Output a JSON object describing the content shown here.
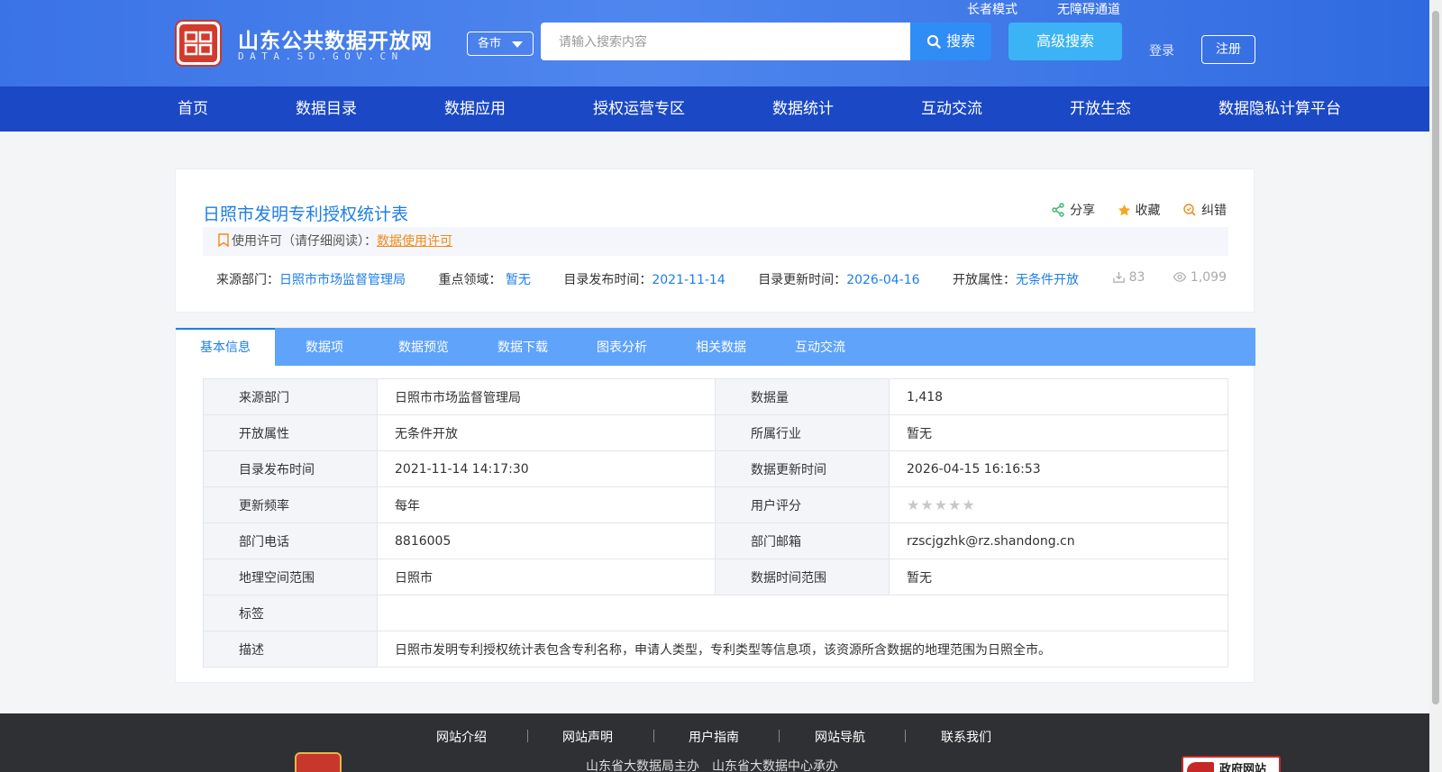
{
  "header": {
    "logo_title": "山东公共数据开放网",
    "logo_subtitle": "DATA.SD.GOV.CN",
    "city_select": "各市",
    "search_placeholder": "请输入搜索内容",
    "search_button": "搜索",
    "advanced_search": "高级搜索",
    "elder_mode": "长者模式",
    "accessibility": "无障碍通道",
    "login": "登录",
    "register": "注册"
  },
  "nav": {
    "items": [
      "首页",
      "数据目录",
      "数据应用",
      "授权运营专区",
      "数据统计",
      "互动交流",
      "开放生态",
      "数据隐私计算平台"
    ]
  },
  "dataset": {
    "title": "日照市发明专利授权统计表",
    "actions": {
      "share": "分享",
      "favorite": "收藏",
      "report": "纠错"
    },
    "license_label": "使用许可（请仔细阅读）：",
    "license_link": "数据使用许可",
    "meta": {
      "source_label": "来源部门：",
      "source_value": "日照市市场监督管理局",
      "domain_label": "重点领域：",
      "domain_value": "暂无",
      "publish_label": "目录发布时间：",
      "publish_value": "2021-11-14",
      "update_label": "目录更新时间：",
      "update_value": "2026-04-16",
      "open_label": "开放属性：",
      "open_value": "无条件开放"
    },
    "downloads": "83",
    "views": "1,099"
  },
  "tabs": [
    "基本信息",
    "数据项",
    "数据预览",
    "数据下载",
    "图表分析",
    "相关数据",
    "互动交流"
  ],
  "info_table": {
    "rows": [
      {
        "k1": "来源部门",
        "v1": "日照市市场监督管理局",
        "k2": "数据量",
        "v2": "1,418"
      },
      {
        "k1": "开放属性",
        "v1": "无条件开放",
        "k2": "所属行业",
        "v2": "暂无"
      },
      {
        "k1": "目录发布时间",
        "v1": "2021-11-14 14:17:30",
        "k2": "数据更新时间",
        "v2": "2026-04-15 16:16:53"
      },
      {
        "k1": "更新频率",
        "v1": "每年",
        "k2": "用户评分",
        "v2": ""
      },
      {
        "k1": "部门电话",
        "v1": "8816005",
        "k2": "部门邮箱",
        "v2": "rzscjgzhk@rz.shandong.cn"
      },
      {
        "k1": "地理空间范围",
        "v1": "日照市",
        "k2": "数据时间范围",
        "v2": "暂无"
      }
    ],
    "tags_label": "标签",
    "tags_value": "",
    "desc_label": "描述",
    "desc_value": "日照市发明专利授权统计表包含专利名称，申请人类型，专利类型等信息项，该资源所含数据的地理范围为日照全市。",
    "rating_stars": 0
  },
  "footer": {
    "links": [
      "网站介绍",
      "网站声明",
      "用户指南",
      "网站导航",
      "联系我们"
    ],
    "credit": "山东省大数据局主办　山东省大数据中心承办",
    "gov_badge": "政府网站"
  },
  "colors": {
    "header_blue": "#3a73e6",
    "nav_blue": "#1b48c4",
    "link_blue": "#1d7ee8",
    "tab_bar": "#5fa3fb",
    "license_orange": "#f08a18"
  }
}
